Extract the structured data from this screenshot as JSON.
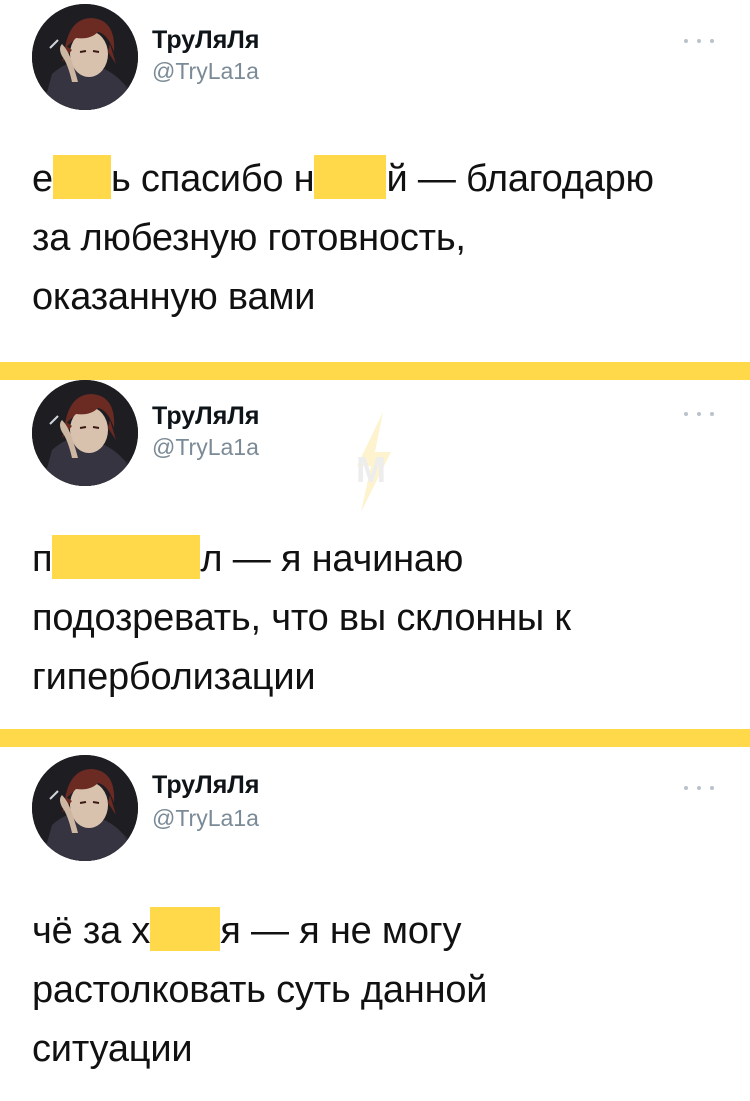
{
  "colors": {
    "censor": "#ffd94a",
    "divider": "#ffd94a",
    "handle": "#7a8a96",
    "text": "#111111"
  },
  "icons": {
    "more": "more-horizontal-icon",
    "watermark": "lightning-m-logo"
  },
  "watermark": {
    "letter": "M"
  },
  "tweets": [
    {
      "author": {
        "name": "ТруЛяЛя",
        "handle": "@TryLa1a"
      },
      "lines": [
        {
          "parts": [
            {
              "type": "text",
              "value": "е"
            },
            {
              "type": "censor"
            },
            {
              "type": "text",
              "value": "ь спасибо н"
            },
            {
              "type": "censor"
            },
            {
              "type": "text",
              "value": "й — благодарю"
            }
          ]
        },
        {
          "parts": [
            {
              "type": "text",
              "value": "за любезную готовность,"
            }
          ]
        },
        {
          "parts": [
            {
              "type": "text",
              "value": "оказанную вами"
            }
          ]
        }
      ]
    },
    {
      "author": {
        "name": "ТруЛяЛя",
        "handle": "@TryLa1a"
      },
      "lines": [
        {
          "parts": [
            {
              "type": "text",
              "value": "п"
            },
            {
              "type": "censor"
            },
            {
              "type": "text",
              "value": "л — я начинаю"
            }
          ]
        },
        {
          "parts": [
            {
              "type": "text",
              "value": "подозревать, что вы склонны к"
            }
          ]
        },
        {
          "parts": [
            {
              "type": "text",
              "value": "гиперболизации"
            }
          ]
        }
      ]
    },
    {
      "author": {
        "name": "ТруЛяЛя",
        "handle": "@TryLa1a"
      },
      "lines": [
        {
          "parts": [
            {
              "type": "text",
              "value": "чё за х"
            },
            {
              "type": "censor"
            },
            {
              "type": "text",
              "value": "я — я не могу"
            }
          ]
        },
        {
          "parts": [
            {
              "type": "text",
              "value": "растолковать суть данной"
            }
          ]
        },
        {
          "parts": [
            {
              "type": "text",
              "value": "ситуации"
            }
          ]
        }
      ]
    }
  ]
}
